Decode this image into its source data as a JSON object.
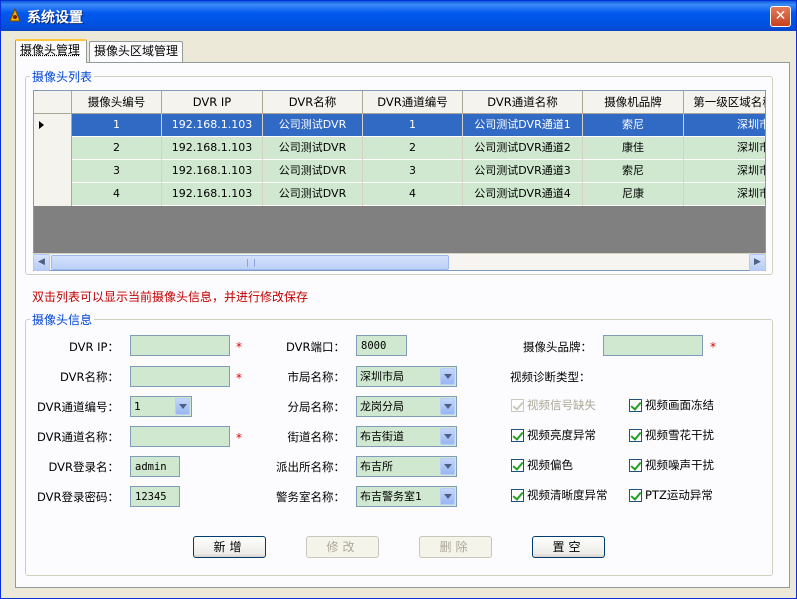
{
  "window": {
    "title": "系统设置",
    "close_glyph": "✕"
  },
  "tabs": [
    {
      "label": "摄像头管理",
      "active": true
    },
    {
      "label": "摄像头区域管理",
      "active": false
    }
  ],
  "camera_list": {
    "legend": "摄像头列表",
    "columns": [
      "摄像头编号",
      "DVR IP",
      "DVR名称",
      "DVR通道编号",
      "DVR通道名称",
      "摄像机品牌",
      "第一级区域名称"
    ],
    "rows": [
      [
        "1",
        "192.168.1.103",
        "公司测试DVR",
        "1",
        "公司测试DVR通道1",
        "索尼",
        "深圳市局"
      ],
      [
        "2",
        "192.168.1.103",
        "公司测试DVR",
        "2",
        "公司测试DVR通道2",
        "康佳",
        "深圳市局"
      ],
      [
        "3",
        "192.168.1.103",
        "公司测试DVR",
        "3",
        "公司测试DVR通道3",
        "索尼",
        "深圳市局"
      ],
      [
        "4",
        "192.168.1.103",
        "公司测试DVR",
        "4",
        "公司测试DVR通道4",
        "尼康",
        "深圳市局"
      ]
    ],
    "selected_row": 0,
    "hscroll_glyphs": {
      "left": "◀",
      "right": "▶"
    }
  },
  "hint": "双击列表可以显示当前摄像头信息，并进行修改保存",
  "camera_info": {
    "legend": "摄像头信息",
    "required_mark": "*",
    "dvr_ip": {
      "label": "DVR IP：",
      "value": ""
    },
    "dvr_name": {
      "label": "DVR名称：",
      "value": ""
    },
    "dvr_channel_no": {
      "label": "DVR通道编号：",
      "value": "1"
    },
    "dvr_channel_name": {
      "label": "DVR通道名称：",
      "value": ""
    },
    "dvr_login_name": {
      "label": "DVR登录名：",
      "value": "admin"
    },
    "dvr_login_pwd": {
      "label": "DVR登录密码：",
      "value": "12345"
    },
    "dvr_port": {
      "label": "DVR端口：",
      "value": "8000"
    },
    "city_bureau": {
      "label": "市局名称：",
      "value": "深圳市局"
    },
    "branch_bureau": {
      "label": "分局名称：",
      "value": "龙岗分局"
    },
    "street": {
      "label": "街道名称：",
      "value": "布吉街道"
    },
    "police_station": {
      "label": "派出所名称：",
      "value": "布吉所"
    },
    "duty_room": {
      "label": "警务室名称：",
      "value": "布吉警务室1"
    },
    "camera_brand": {
      "label": "摄像头品牌：",
      "value": ""
    },
    "diagnosis_label": "视频诊断类型：",
    "diagnosis": [
      {
        "label": "视频信号缺失",
        "checked": true,
        "disabled": true
      },
      {
        "label": "视频画面冻结",
        "checked": true,
        "disabled": false
      },
      {
        "label": "视频亮度异常",
        "checked": true,
        "disabled": false
      },
      {
        "label": "视频雪花干扰",
        "checked": true,
        "disabled": false
      },
      {
        "label": "视频偏色",
        "checked": true,
        "disabled": false
      },
      {
        "label": "视频噪声干扰",
        "checked": true,
        "disabled": false
      },
      {
        "label": "视频清晰度异常",
        "checked": true,
        "disabled": false
      },
      {
        "label": "PTZ运动异常",
        "checked": true,
        "disabled": false
      }
    ]
  },
  "buttons": {
    "add": "新增",
    "modify": "修改",
    "delete": "删除",
    "clear": "置空"
  },
  "colors": {
    "title_bar": "#0058ee",
    "row_fill": "#cfe8cf",
    "selected_row": "#316ac5",
    "legend_text": "#0046d5",
    "hint_text": "#c00000"
  }
}
